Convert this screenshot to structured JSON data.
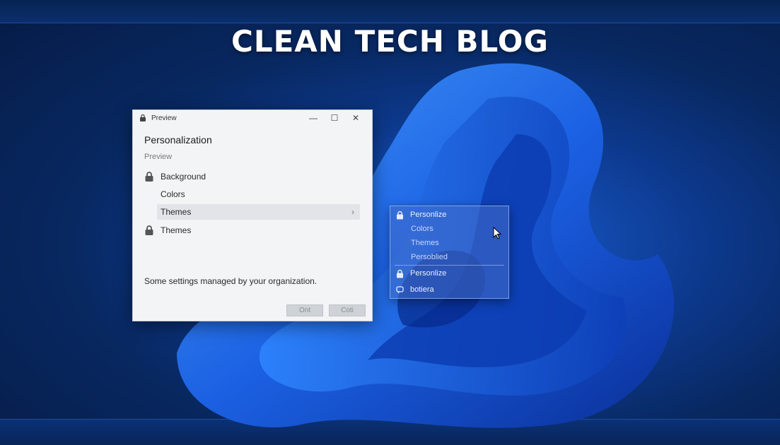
{
  "site": {
    "title": "CLEAN TECH BLOG"
  },
  "window": {
    "title": "Preview",
    "heading": "Personalization",
    "subheading": "Preview",
    "items": [
      {
        "label": "Background",
        "icon": "lock-icon",
        "locked": true
      },
      {
        "label": "Colors",
        "locked": false
      },
      {
        "label": "Themes",
        "selected": true,
        "icon": "chevron-right-icon"
      },
      {
        "label": "Themes",
        "icon": "lock-icon",
        "locked": true
      }
    ],
    "footer_text": "Some settings managed by your organization.",
    "buttons": {
      "ok": "Ont",
      "cancel": "Coti"
    },
    "controls": {
      "minimize": "—",
      "maximize": "☐",
      "close": "✕"
    }
  },
  "flyout": {
    "items": [
      {
        "label": "Personlize",
        "icon": "lock-icon"
      },
      {
        "label": "Colors"
      },
      {
        "label": "Themes"
      },
      {
        "label": "Persoblied"
      },
      {
        "label": "Personlize",
        "icon": "lock-icon"
      },
      {
        "label": "botiera",
        "icon": "chat-icon"
      }
    ]
  },
  "colors": {
    "accent": "#1a5fd6",
    "window_bg": "#f3f4f6"
  }
}
